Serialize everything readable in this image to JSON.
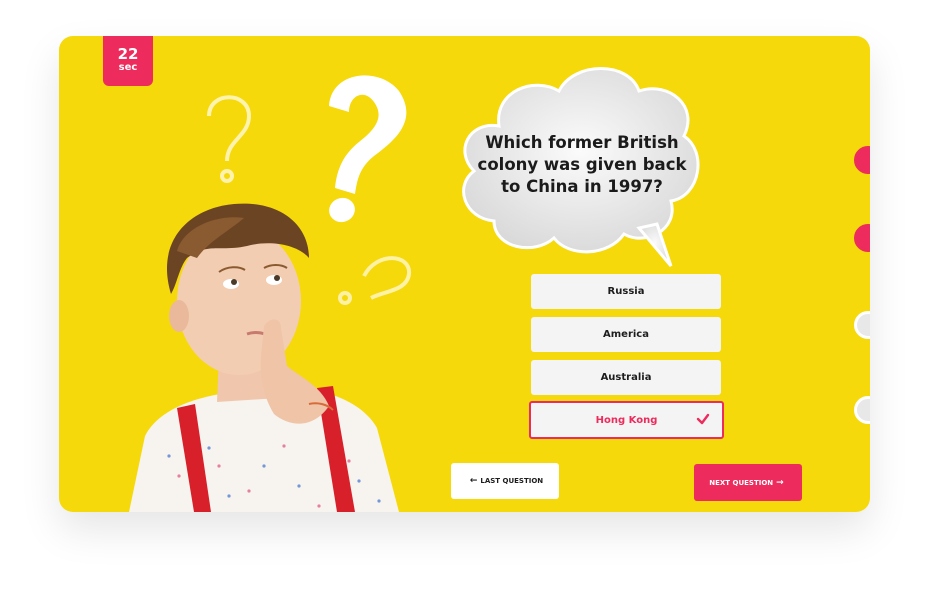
{
  "timer": {
    "value": "22",
    "unit": "sec"
  },
  "question": {
    "text": "Which former British colony was given back to China in 1997?"
  },
  "answers": [
    {
      "label": "Russia",
      "selected": false
    },
    {
      "label": "America",
      "selected": false
    },
    {
      "label": "Australia",
      "selected": false
    },
    {
      "label": "Hong Kong",
      "selected": true
    }
  ],
  "navigation": {
    "last_label": "LAST QUESTION",
    "next_label": "NEXT QUESTION",
    "last_icon": "arrow-left-icon",
    "next_icon": "arrow-right-icon"
  },
  "colors": {
    "background": "#f5d90a",
    "accent": "#ed2b5c",
    "answer_bg": "#f4f4f4"
  }
}
